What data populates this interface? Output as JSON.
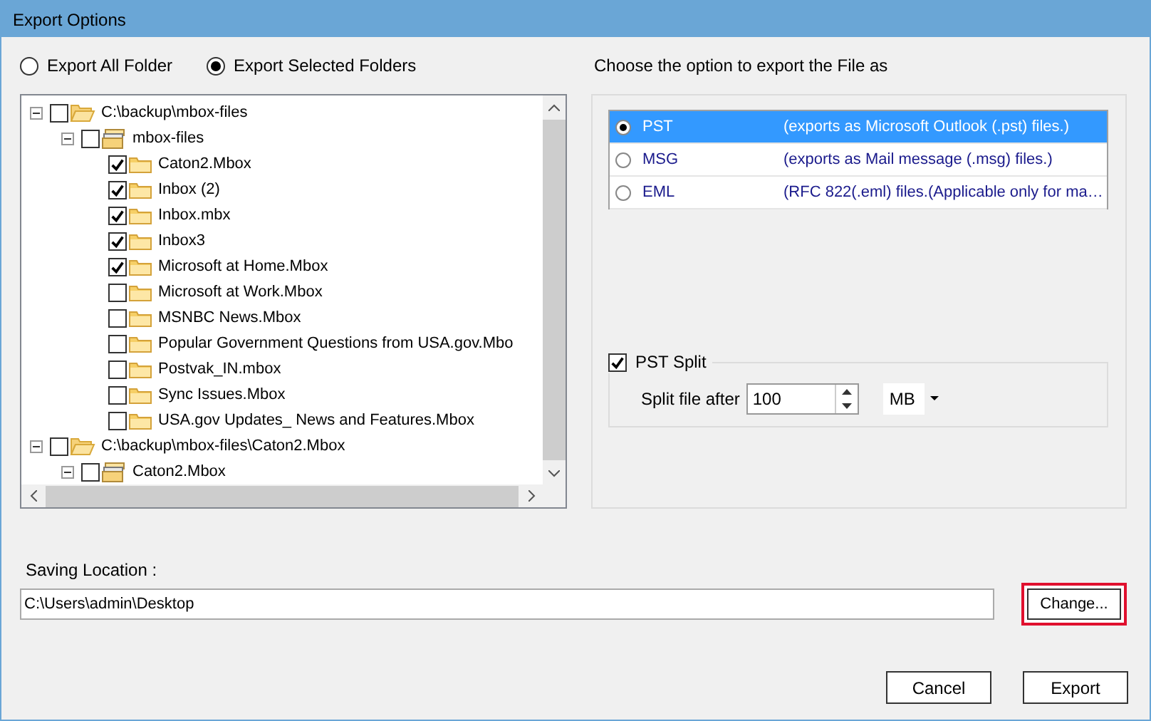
{
  "window": {
    "title": "Export Options"
  },
  "scope_options": [
    {
      "label": "Export All Folder",
      "selected": false
    },
    {
      "label": "Export Selected Folders",
      "selected": true
    }
  ],
  "folder_tree": [
    {
      "label": "C:\\backup\\mbox-files",
      "kind": "drive",
      "checked": false,
      "expanded": true,
      "children": [
        {
          "label": "mbox-files",
          "kind": "store",
          "checked": false,
          "expanded": true,
          "children": [
            {
              "label": "Caton2.Mbox",
              "kind": "folder",
              "checked": true
            },
            {
              "label": "Inbox (2)",
              "kind": "folder",
              "checked": true
            },
            {
              "label": "Inbox.mbx",
              "kind": "folder",
              "checked": true
            },
            {
              "label": "Inbox3",
              "kind": "folder",
              "checked": true
            },
            {
              "label": "Microsoft at Home.Mbox",
              "kind": "folder",
              "checked": true
            },
            {
              "label": "Microsoft at Work.Mbox",
              "kind": "folder",
              "checked": false
            },
            {
              "label": "MSNBC News.Mbox",
              "kind": "folder",
              "checked": false
            },
            {
              "label": "Popular Government Questions from USA.gov.Mbo",
              "kind": "folder",
              "checked": false
            },
            {
              "label": "Postvak_IN.mbox",
              "kind": "folder",
              "checked": false
            },
            {
              "label": "Sync Issues.Mbox",
              "kind": "folder",
              "checked": false
            },
            {
              "label": "USA.gov Updates_ News and Features.Mbox",
              "kind": "folder",
              "checked": false
            }
          ]
        }
      ]
    },
    {
      "label": "C:\\backup\\mbox-files\\Caton2.Mbox",
      "kind": "drive",
      "checked": false,
      "expanded": true,
      "children": [
        {
          "label": "Caton2.Mbox",
          "kind": "store",
          "checked": false,
          "expanded": true
        }
      ]
    }
  ],
  "format_heading": "Choose the option to export the File as",
  "formats": [
    {
      "name": "PST",
      "description": "(exports as Microsoft Outlook (.pst) files.)",
      "selected": true
    },
    {
      "name": "MSG",
      "description": "(exports as Mail message (.msg) files.)",
      "selected": false
    },
    {
      "name": "EML",
      "description": "(RFC 822(.eml) files.(Applicable only for ma…",
      "selected": false
    }
  ],
  "pst_split": {
    "label": "PST Split",
    "checked": true,
    "size_label": "Split file after",
    "size_value": "100",
    "unit": "MB"
  },
  "saving_location": {
    "label": "Saving Location :",
    "value": "C:\\Users\\admin\\Desktop",
    "change_button": {
      "label": "Change...",
      "highlighted": true
    }
  },
  "buttons": [
    "Cancel",
    "Export"
  ]
}
